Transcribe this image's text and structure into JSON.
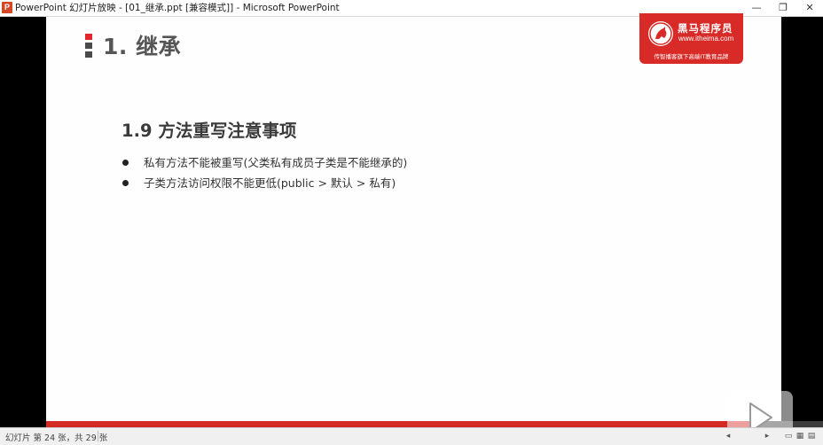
{
  "window": {
    "title": "PowerPoint 幻灯片放映 - [01_继承.ppt [兼容模式]] - Microsoft PowerPoint",
    "app_icon_letter": "P",
    "minimize_glyph": "—",
    "restore_glyph": "❐",
    "close_glyph": "✕"
  },
  "slide": {
    "title": "1. 继承",
    "logo": {
      "name": "黑马程序员",
      "url": "www.itheima.com",
      "tagline": "传智播客旗下高端IT教育品牌"
    },
    "heading": "1.9 方法重写注意事项",
    "bullets": [
      "私有方法不能被重写(父类私有成员子类是不能继承的)",
      "子类方法访问权限不能更低(public > 默认 > 私有)"
    ]
  },
  "status": {
    "slide_info": "幻灯片 第 24 张，共 29 张"
  },
  "colors": {
    "accent_red": "#d82a26",
    "title_gray": "#555555"
  }
}
